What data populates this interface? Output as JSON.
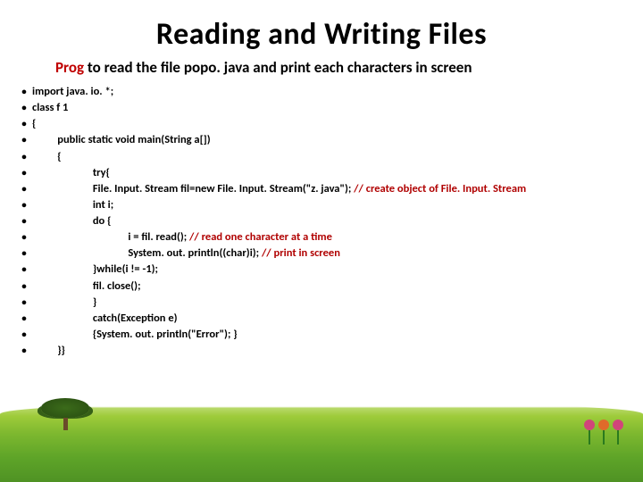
{
  "title": "Reading and Writing Files",
  "subtitle": {
    "prefix": "Prog",
    "rest": " to read the file popo. java and print each characters in screen"
  },
  "code": [
    {
      "text": "import java. io. *;"
    },
    {
      "text": "class f 1"
    },
    {
      "text": "{"
    },
    {
      "text": "          public static void main(String a[])"
    },
    {
      "text": "          {"
    },
    {
      "text": "                        try{"
    },
    {
      "text": "                        File. Input. Stream fil=new File. Input. Stream(\"z. java\"); ",
      "comment": "// create object of File. Input. Stream"
    },
    {
      "text": "                        int i;"
    },
    {
      "text": "                        do {"
    },
    {
      "text": "                                      i = fil. read(); ",
      "comment": "// read one character at a time"
    },
    {
      "text": "                                      System. out. println((char)i); ",
      "comment": "// print in screen"
    },
    {
      "text": "                        }while(i != -1);"
    },
    {
      "text": "                        fil. close();"
    },
    {
      "text": "                        }"
    },
    {
      "text": "                        catch(Exception e)"
    },
    {
      "text": "                        {System. out. println(\"Error\"); }"
    },
    {
      "text": "          }}"
    }
  ]
}
